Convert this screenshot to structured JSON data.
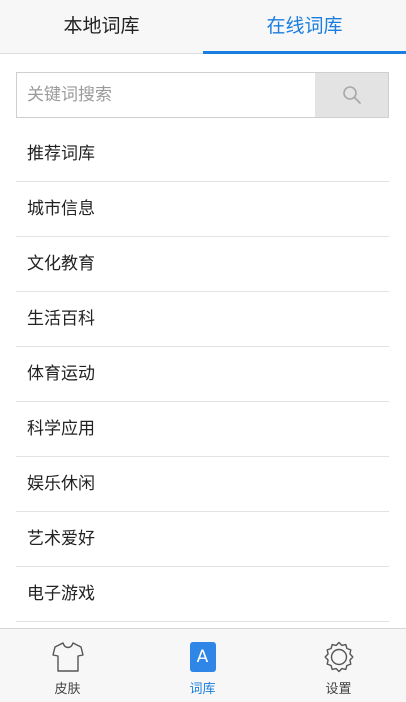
{
  "tabs": {
    "local_label": "本地词库",
    "online_label": "在线词库",
    "active": "online"
  },
  "search": {
    "placeholder": "关键词搜索",
    "value": "",
    "button_icon": "search-icon"
  },
  "categories": [
    "推荐词库",
    "城市信息",
    "文化教育",
    "生活百科",
    "体育运动",
    "科学应用",
    "娱乐休闲",
    "艺术爱好",
    "电子游戏"
  ],
  "bottom_nav": {
    "items": [
      {
        "label": "皮肤",
        "icon": "tshirt-icon"
      },
      {
        "label": "词库",
        "icon": "library-a-icon",
        "badge": "A"
      },
      {
        "label": "设置",
        "icon": "gear-icon"
      }
    ],
    "active_index": 1
  },
  "colors": {
    "accent": "#1a7de0",
    "badge": "#2f86e6",
    "text": "#222222"
  }
}
